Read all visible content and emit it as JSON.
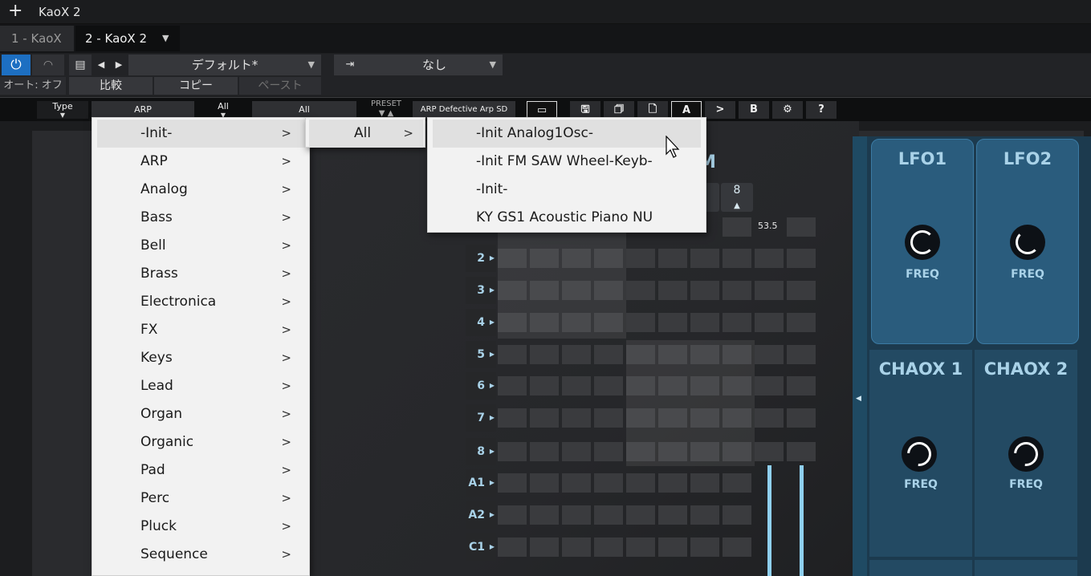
{
  "window": {
    "title": "KaoX 2"
  },
  "tabs": [
    {
      "label": "1 - KaoX"
    },
    {
      "label": "2 - KaoX 2"
    }
  ],
  "host_controls": {
    "preset_name": "デフォルト*",
    "sidechain_value": "なし",
    "auto_label": "オート: オフ",
    "compare_label": "比較",
    "copy_label": "コピー",
    "paste_label": "ペースト"
  },
  "plugin_header": {
    "type_label": "Type",
    "type_value": "ARP",
    "filter_label": "All",
    "filter_value": "All",
    "preset_label": "PRESET",
    "preset_value": "ARP Defective Arp SD",
    "a_label": "A",
    "arrow_label": ">",
    "b_label": "B",
    "help_label": "?"
  },
  "grid": {
    "title_fragment": "M",
    "step_label": "8",
    "value_readout": "53.5",
    "row_labels": [
      "2",
      "3",
      "4",
      "5",
      "6",
      "7",
      "8",
      "A1",
      "A2",
      "C1"
    ]
  },
  "modulators": [
    {
      "title": "LFO1",
      "knob_label": "FREQ"
    },
    {
      "title": "LFO2",
      "knob_label": "FREQ"
    },
    {
      "title": "CHAOX 1",
      "knob_label": "FREQ"
    },
    {
      "title": "CHAOX 2",
      "knob_label": "FREQ"
    }
  ],
  "menus": {
    "categories": [
      "-Init-",
      "ARP",
      "Analog",
      "Bass",
      "Bell",
      "Brass",
      "Electronica",
      "FX",
      "Keys",
      "Lead",
      "Organ",
      "Organic",
      "Pad",
      "Perc",
      "Pluck",
      "Sequence"
    ],
    "subcategory": [
      "All"
    ],
    "presets": [
      "-Init Analog1Osc-",
      "-Init FM SAW Wheel-Keyb-",
      "-Init-",
      "KY GS1 Acoustic Piano NU"
    ]
  },
  "colors": {
    "accent_blue": "#1d6fc2",
    "mod_panel": "#2a5c7d",
    "label_blue": "#a9d2e8"
  }
}
